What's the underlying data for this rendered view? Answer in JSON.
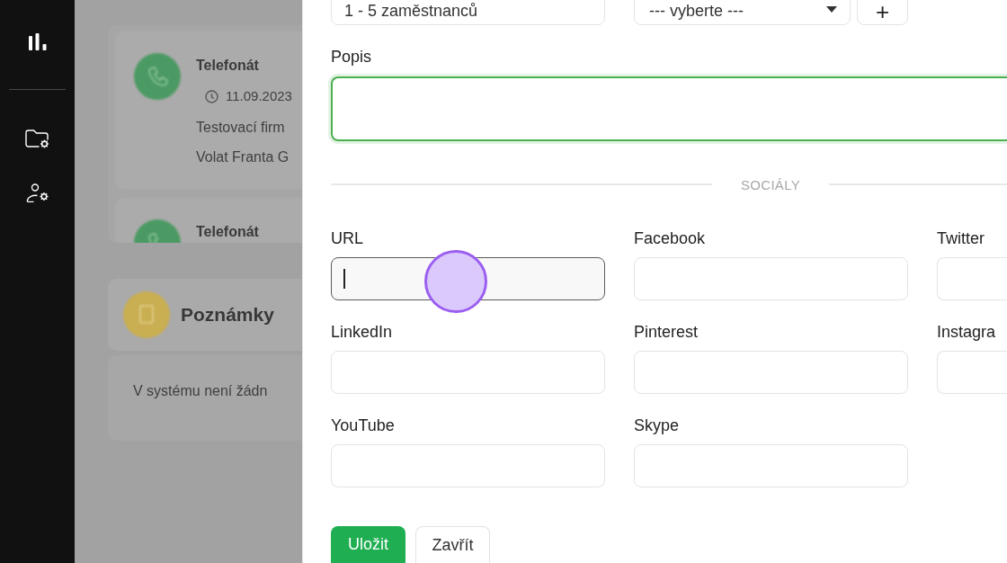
{
  "background": {
    "activities": [
      {
        "title": "Telefonát",
        "date": "11.09.2023",
        "company": "Testovací firm",
        "note": "Volat Franta G"
      },
      {
        "title": "Telefonát"
      }
    ],
    "notes": {
      "title": "Poznámky",
      "empty_text": "V systému není žádn"
    }
  },
  "form": {
    "company_size": {
      "value": "1 - 5 zaměstnanců"
    },
    "select": {
      "value": "--- vyberte ---"
    },
    "add_button": "+",
    "description": {
      "label": "Popis",
      "valid": true
    },
    "section_title": "SOCIÁLY",
    "social_fields": [
      {
        "label": "URL",
        "focused": true
      },
      {
        "label": "Facebook",
        "focused": false
      },
      {
        "label": "Twitter",
        "focused": false
      },
      {
        "label": "LinkedIn",
        "focused": false
      },
      {
        "label": "Pinterest",
        "focused": false
      },
      {
        "label": "Instagra",
        "focused": false
      },
      {
        "label": "YouTube",
        "focused": false
      },
      {
        "label": "Skype",
        "focused": false
      }
    ],
    "buttons": [
      {
        "label": "Uložit",
        "kind": "primary"
      },
      {
        "label": "Zavřít",
        "kind": "secondary"
      }
    ]
  }
}
